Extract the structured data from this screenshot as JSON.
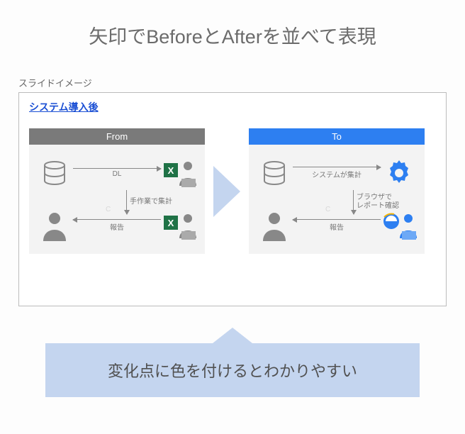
{
  "title": "矢印でBeforeとAfterを並べて表現",
  "slide_label": "スライドイメージ",
  "slide_link": "システム導入後",
  "panels": {
    "from": {
      "header": "From",
      "arrow1_label": "DL",
      "vertical_label": "手作業で集計",
      "arrow2_label": "報告",
      "c_label": "C"
    },
    "to": {
      "header": "To",
      "arrow1_label": "システムが集計",
      "vertical_label": "ブラウザで\nレポート確認",
      "arrow2_label": "報告",
      "c_label": "C"
    }
  },
  "footer": "変化点に色を付けるとわかりやすい",
  "icons": {
    "database": "database-icon",
    "excel_user": "excel-user-icon",
    "person": "person-icon",
    "gear": "gear-icon",
    "ie_user": "ie-user-icon"
  }
}
